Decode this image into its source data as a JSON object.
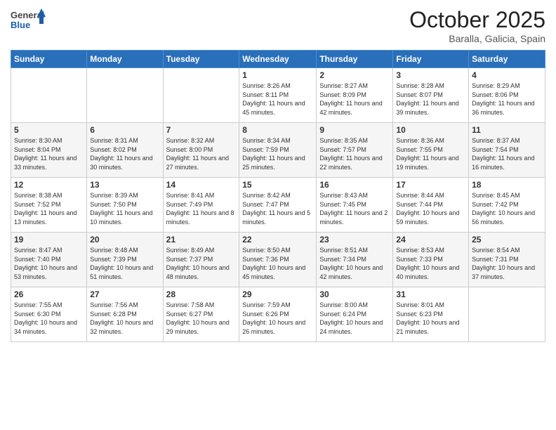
{
  "header": {
    "logo_general": "General",
    "logo_blue": "Blue",
    "month_year": "October 2025",
    "location": "Baralla, Galicia, Spain"
  },
  "days_of_week": [
    "Sunday",
    "Monday",
    "Tuesday",
    "Wednesday",
    "Thursday",
    "Friday",
    "Saturday"
  ],
  "weeks": [
    [
      {
        "day": "",
        "content": ""
      },
      {
        "day": "",
        "content": ""
      },
      {
        "day": "",
        "content": ""
      },
      {
        "day": "1",
        "content": "Sunrise: 8:26 AM\nSunset: 8:11 PM\nDaylight: 11 hours and 45 minutes."
      },
      {
        "day": "2",
        "content": "Sunrise: 8:27 AM\nSunset: 8:09 PM\nDaylight: 11 hours and 42 minutes."
      },
      {
        "day": "3",
        "content": "Sunrise: 8:28 AM\nSunset: 8:07 PM\nDaylight: 11 hours and 39 minutes."
      },
      {
        "day": "4",
        "content": "Sunrise: 8:29 AM\nSunset: 8:06 PM\nDaylight: 11 hours and 36 minutes."
      }
    ],
    [
      {
        "day": "5",
        "content": "Sunrise: 8:30 AM\nSunset: 8:04 PM\nDaylight: 11 hours and 33 minutes."
      },
      {
        "day": "6",
        "content": "Sunrise: 8:31 AM\nSunset: 8:02 PM\nDaylight: 11 hours and 30 minutes."
      },
      {
        "day": "7",
        "content": "Sunrise: 8:32 AM\nSunset: 8:00 PM\nDaylight: 11 hours and 27 minutes."
      },
      {
        "day": "8",
        "content": "Sunrise: 8:34 AM\nSunset: 7:59 PM\nDaylight: 11 hours and 25 minutes."
      },
      {
        "day": "9",
        "content": "Sunrise: 8:35 AM\nSunset: 7:57 PM\nDaylight: 11 hours and 22 minutes."
      },
      {
        "day": "10",
        "content": "Sunrise: 8:36 AM\nSunset: 7:55 PM\nDaylight: 11 hours and 19 minutes."
      },
      {
        "day": "11",
        "content": "Sunrise: 8:37 AM\nSunset: 7:54 PM\nDaylight: 11 hours and 16 minutes."
      }
    ],
    [
      {
        "day": "12",
        "content": "Sunrise: 8:38 AM\nSunset: 7:52 PM\nDaylight: 11 hours and 13 minutes."
      },
      {
        "day": "13",
        "content": "Sunrise: 8:39 AM\nSunset: 7:50 PM\nDaylight: 11 hours and 10 minutes."
      },
      {
        "day": "14",
        "content": "Sunrise: 8:41 AM\nSunset: 7:49 PM\nDaylight: 11 hours and 8 minutes."
      },
      {
        "day": "15",
        "content": "Sunrise: 8:42 AM\nSunset: 7:47 PM\nDaylight: 11 hours and 5 minutes."
      },
      {
        "day": "16",
        "content": "Sunrise: 8:43 AM\nSunset: 7:45 PM\nDaylight: 11 hours and 2 minutes."
      },
      {
        "day": "17",
        "content": "Sunrise: 8:44 AM\nSunset: 7:44 PM\nDaylight: 10 hours and 59 minutes."
      },
      {
        "day": "18",
        "content": "Sunrise: 8:45 AM\nSunset: 7:42 PM\nDaylight: 10 hours and 56 minutes."
      }
    ],
    [
      {
        "day": "19",
        "content": "Sunrise: 8:47 AM\nSunset: 7:40 PM\nDaylight: 10 hours and 53 minutes."
      },
      {
        "day": "20",
        "content": "Sunrise: 8:48 AM\nSunset: 7:39 PM\nDaylight: 10 hours and 51 minutes."
      },
      {
        "day": "21",
        "content": "Sunrise: 8:49 AM\nSunset: 7:37 PM\nDaylight: 10 hours and 48 minutes."
      },
      {
        "day": "22",
        "content": "Sunrise: 8:50 AM\nSunset: 7:36 PM\nDaylight: 10 hours and 45 minutes."
      },
      {
        "day": "23",
        "content": "Sunrise: 8:51 AM\nSunset: 7:34 PM\nDaylight: 10 hours and 42 minutes."
      },
      {
        "day": "24",
        "content": "Sunrise: 8:53 AM\nSunset: 7:33 PM\nDaylight: 10 hours and 40 minutes."
      },
      {
        "day": "25",
        "content": "Sunrise: 8:54 AM\nSunset: 7:31 PM\nDaylight: 10 hours and 37 minutes."
      }
    ],
    [
      {
        "day": "26",
        "content": "Sunrise: 7:55 AM\nSunset: 6:30 PM\nDaylight: 10 hours and 34 minutes."
      },
      {
        "day": "27",
        "content": "Sunrise: 7:56 AM\nSunset: 6:28 PM\nDaylight: 10 hours and 32 minutes."
      },
      {
        "day": "28",
        "content": "Sunrise: 7:58 AM\nSunset: 6:27 PM\nDaylight: 10 hours and 29 minutes."
      },
      {
        "day": "29",
        "content": "Sunrise: 7:59 AM\nSunset: 6:26 PM\nDaylight: 10 hours and 26 minutes."
      },
      {
        "day": "30",
        "content": "Sunrise: 8:00 AM\nSunset: 6:24 PM\nDaylight: 10 hours and 24 minutes."
      },
      {
        "day": "31",
        "content": "Sunrise: 8:01 AM\nSunset: 6:23 PM\nDaylight: 10 hours and 21 minutes."
      },
      {
        "day": "",
        "content": ""
      }
    ]
  ]
}
